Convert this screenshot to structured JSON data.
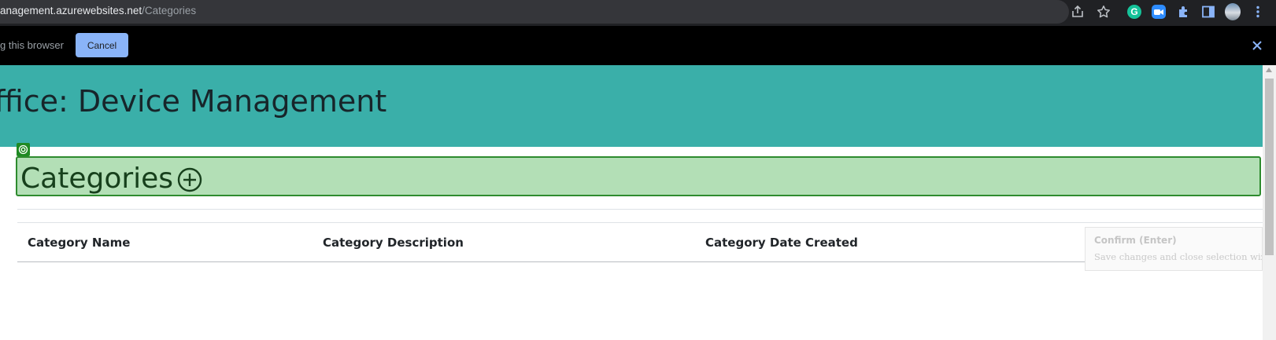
{
  "browser": {
    "url_host": "anagement.azurewebsites.net",
    "url_path": "/Categories",
    "toolbar_icons": [
      "share-icon",
      "star-icon",
      "grammarly-icon",
      "zoom-icon",
      "extensions-icon",
      "side-panel-icon",
      "profile-avatar",
      "kebab-menu-icon"
    ],
    "grammarly_letter": "G"
  },
  "share_bar": {
    "text": "g this browser",
    "cancel_label": "Cancel",
    "close_glyph": "✕"
  },
  "header": {
    "title": "ffice: Device Management"
  },
  "categories": {
    "title": "Categories"
  },
  "table": {
    "columns": [
      "Category Name",
      "Category Description",
      "Category Date Created"
    ]
  },
  "tooltip": {
    "title": "Confirm (Enter)",
    "description": "Save changes and close selection wizard."
  },
  "colors": {
    "header_bg": "#3aafa9",
    "header_text": "#17252a",
    "selection_bg": "#b3dfb6",
    "selection_border": "#2e8b2e",
    "cancel_button": "#8ab4f8"
  }
}
